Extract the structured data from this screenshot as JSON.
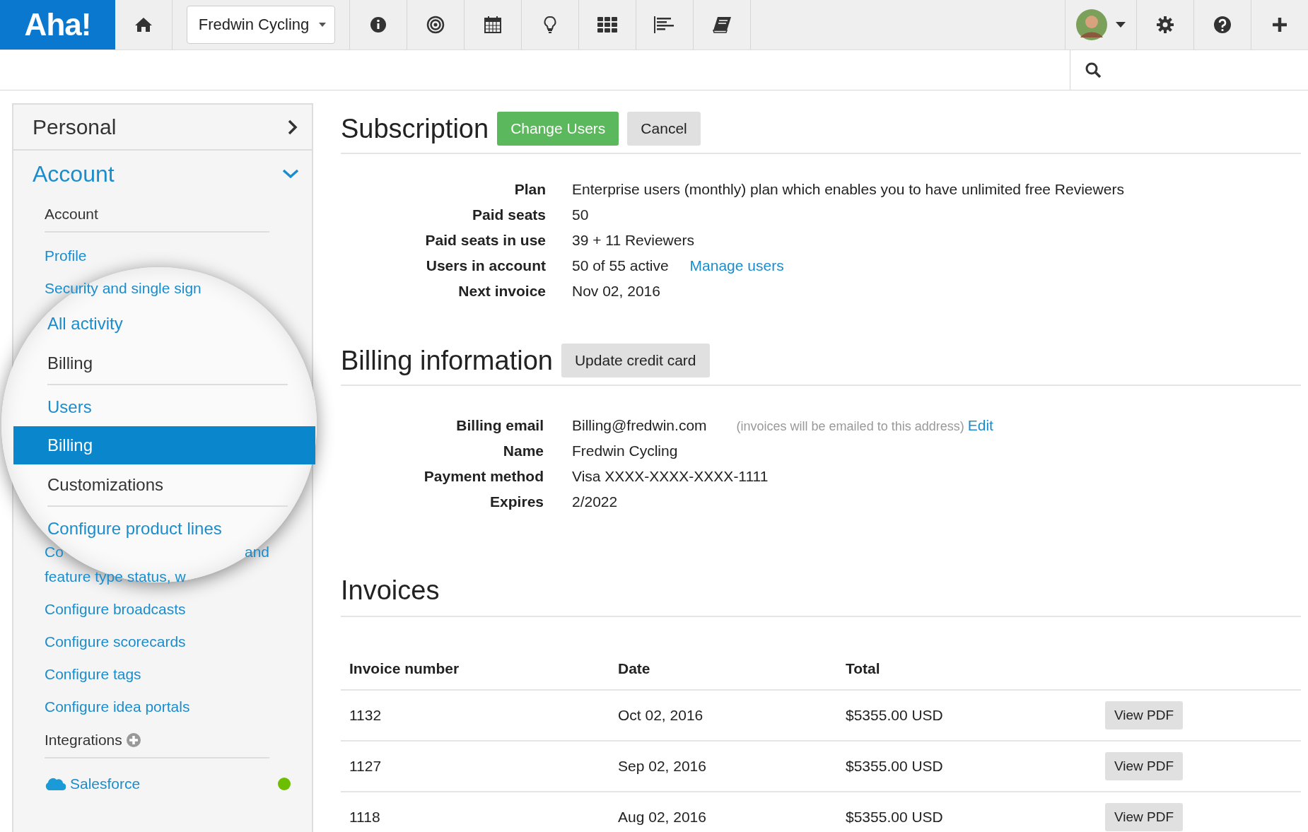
{
  "topbar": {
    "logo": "Aha!",
    "workspace": "Fredwin Cycling"
  },
  "sidebar": {
    "personal": "Personal",
    "section": "Account",
    "expanded": true,
    "items": [
      {
        "kind": "heading",
        "label": "Account",
        "magnified": false
      },
      {
        "kind": "link",
        "label": "Profile",
        "magnified": false,
        "selected": false
      },
      {
        "kind": "link",
        "label": "Security and single sign",
        "magnified": false,
        "selected": false
      },
      {
        "kind": "link",
        "label": "All activity",
        "magnified": true,
        "selected": false
      },
      {
        "kind": "heading",
        "label": "Billing",
        "magnified": true
      },
      {
        "kind": "link",
        "label": "Users",
        "magnified": true,
        "selected": false
      },
      {
        "kind": "link",
        "label": "Billing",
        "magnified": true,
        "selected": true
      },
      {
        "kind": "heading",
        "label": "Customizations",
        "magnified": true
      },
      {
        "kind": "link",
        "label": "Configure product lines",
        "magnified": true,
        "selected": false
      },
      {
        "kind": "split",
        "parts": [
          "Co",
          "and"
        ]
      },
      {
        "kind": "link",
        "label": "feature type status, w",
        "magnified": false,
        "selected": false
      },
      {
        "kind": "link",
        "label": "Configure broadcasts",
        "magnified": false,
        "selected": false
      },
      {
        "kind": "link",
        "label": "Configure scorecards",
        "magnified": false,
        "selected": false
      },
      {
        "kind": "link",
        "label": "Configure tags",
        "magnified": false,
        "selected": false
      },
      {
        "kind": "link",
        "label": "Configure idea portals",
        "magnified": false,
        "selected": false
      },
      {
        "kind": "heading",
        "label": "Integrations",
        "magnified": false,
        "add": true
      },
      {
        "kind": "integration",
        "label": "Salesforce",
        "color": "#6cbf00"
      }
    ]
  },
  "subscription": {
    "title": "Subscription",
    "buttons": [
      {
        "label": "Change Users",
        "kind": "primary"
      },
      {
        "label": "Cancel",
        "kind": "default"
      }
    ],
    "fields": [
      {
        "label": "Plan",
        "value": "Enterprise users (monthly) plan which enables you to have unlimited free Reviewers"
      },
      {
        "label": "Paid seats",
        "value": "50"
      },
      {
        "label": "Paid seats in use",
        "value": "39 + 11 Reviewers"
      },
      {
        "label": "Users in account",
        "value": "50 of 55 active",
        "link": "Manage users"
      },
      {
        "label": "Next invoice",
        "value": "Nov 02, 2016"
      }
    ]
  },
  "billing": {
    "title": "Billing information",
    "button": "Update credit card",
    "fields": [
      {
        "label": "Billing email",
        "value": "Billing@fredwin.com",
        "note": "(invoices will be emailed to this address)",
        "link": "Edit"
      },
      {
        "label": "Name",
        "value": "Fredwin Cycling"
      },
      {
        "label": "Payment method",
        "value": "Visa XXXX-XXXX-XXXX-1111"
      },
      {
        "label": "Expires",
        "value": "2/2022"
      }
    ]
  },
  "invoices": {
    "title": "Invoices",
    "columns": [
      "Invoice number",
      "Date",
      "Total"
    ],
    "rows": [
      {
        "number": "1132",
        "date": "Oct 02, 2016",
        "total": "$5355.00 USD",
        "action": "View PDF"
      },
      {
        "number": "1127",
        "date": "Sep 02, 2016",
        "total": "$5355.00 USD",
        "action": "View PDF"
      },
      {
        "number": "1118",
        "date": "Aug 02, 2016",
        "total": "$5355.00 USD",
        "action": "View PDF"
      }
    ]
  }
}
